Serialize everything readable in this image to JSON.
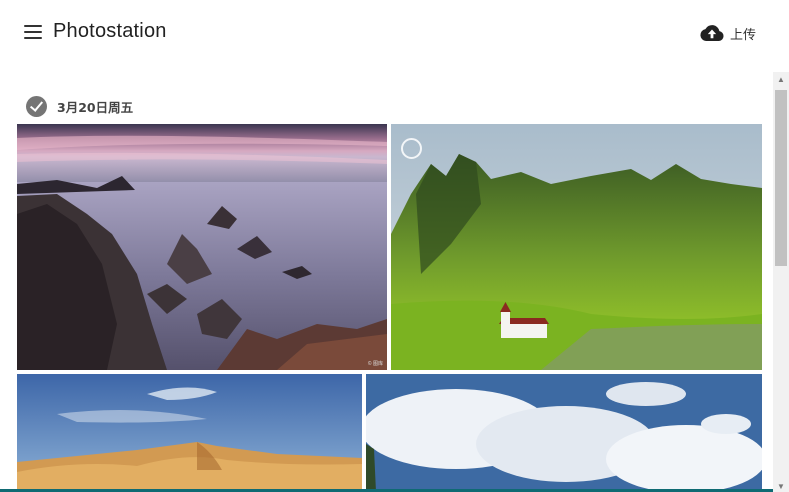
{
  "header": {
    "app_title": "Photostation",
    "upload_label": "上传",
    "menu_icon": "hamburger-menu-icon",
    "upload_icon": "cloud-upload-icon"
  },
  "gallery": {
    "groups": [
      {
        "date_label": "3月20日周五",
        "check_icon": "check-circle-icon",
        "photos": [
          {
            "name": "coastal-rocks-sunset",
            "watermark": "© 图库"
          },
          {
            "name": "green-mountain-church"
          },
          {
            "name": "desert-dunes"
          },
          {
            "name": "clouds-sky"
          }
        ]
      }
    ]
  },
  "colors": {
    "text_dark": "#222222",
    "icon_grey": "#757575",
    "bottom_strip": "#0f6a73"
  }
}
